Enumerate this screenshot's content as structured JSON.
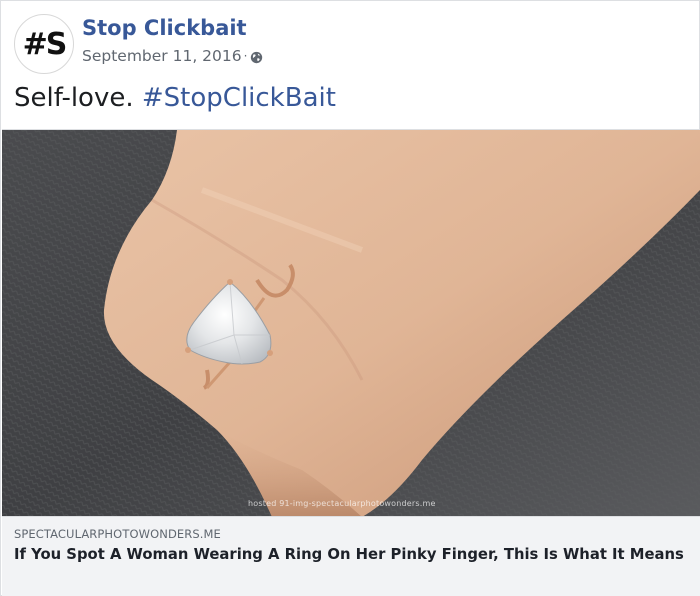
{
  "post": {
    "avatar_text": "#S",
    "page_name": "Stop Clickbait",
    "date": "September 11, 2016",
    "separator": "·",
    "privacy_icon": "globe-icon",
    "message_text": "Self-love.",
    "message_hashtag": "#StopClickBait"
  },
  "photo": {
    "alt": "Hand wearing a heart-shaped diamond ring on a finger against a grey knit sweater",
    "watermark": "hosted  91-img-spectacularphotowonders.me"
  },
  "link_preview": {
    "domain": "SPECTACULARPHOTOWONDERS.ME",
    "title": "If You Spot A Woman Wearing A Ring On Her Pinky Finger, This Is What It Means"
  },
  "colors": {
    "link_blue": "#385898",
    "meta_grey": "#606770",
    "preview_bg": "#f2f3f5",
    "border": "#dddfe2"
  }
}
